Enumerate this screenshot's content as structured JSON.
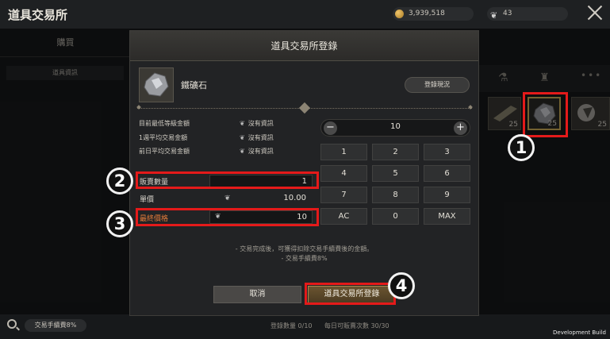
{
  "header": {
    "title": "道具交易所",
    "gold": "3,939,518",
    "feathers": "43"
  },
  "left": {
    "tab_buy": "購買",
    "side_info": "道具資訊"
  },
  "inventory": {
    "items": [
      {
        "count": "25"
      },
      {
        "count": "25",
        "selected": true
      },
      {
        "count": "25"
      }
    ],
    "more": "•••"
  },
  "dialog": {
    "title": "道具交易所登錄",
    "item_name": "鐵礦石",
    "status_button": "登錄現況",
    "info": [
      {
        "label": "目前最低等級金額",
        "value": "沒有資訊"
      },
      {
        "label": "1週平均交易金額",
        "value": "沒有資訊"
      },
      {
        "label": "前日平均交易金額",
        "value": "沒有資訊"
      }
    ],
    "sell_qty_label": "販賣數量",
    "sell_qty_value": "1",
    "unit_price_label": "單價",
    "unit_price_value": "10.00",
    "final_price_label": "最終價格",
    "final_price_value": "10",
    "quantity": "10",
    "minus": "−",
    "plus": "+",
    "keys": [
      "1",
      "2",
      "3",
      "4",
      "5",
      "6",
      "7",
      "8",
      "9",
      "AC",
      "0",
      "MAX"
    ],
    "note_line1": "- 交易完成後，可獲得扣除交易手續費後的金額。",
    "note_line2": "- 交易手續費8%",
    "cancel": "取消",
    "register": "道具交易所登錄"
  },
  "footer": {
    "fee_pill": "交易手續費8%",
    "reg_count": "登錄數量 0/10",
    "daily_count": "每日可販賣次數 30/30",
    "dev_build": "Development Build"
  },
  "annotations": [
    "1",
    "2",
    "3",
    "4"
  ],
  "colors": {
    "highlight": "#e41a1a",
    "accent_gold": "#d4b35a"
  }
}
